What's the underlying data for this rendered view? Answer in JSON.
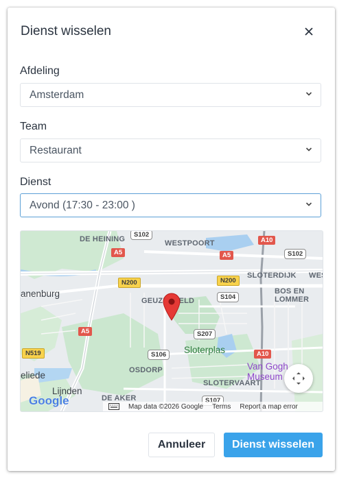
{
  "dialog": {
    "title": "Dienst wisselen"
  },
  "fields": {
    "afdeling": {
      "label": "Afdeling",
      "value": "Amsterdam"
    },
    "team": {
      "label": "Team",
      "value": "Restaurant"
    },
    "dienst": {
      "label": "Dienst",
      "value": "Avond (17:30 - 23:00 )"
    }
  },
  "map": {
    "areas": [
      "DE HEINING",
      "WESTPOORT",
      "SLOTERDIJK",
      "BOS EN",
      "LOMMER",
      "WES",
      "GEUZENVELD",
      "OSDORP",
      "SLOTERVAART",
      "DE AKER"
    ],
    "places": [
      "anenburg",
      "Sloterplas",
      "Van Gogh Museum",
      "eliede",
      "Lijnden"
    ],
    "roads": {
      "s102a": "S102",
      "s102b": "S102",
      "a10a": "A10",
      "a10b": "A10",
      "a5a": "A5",
      "a5b": "A5",
      "a5c": "A5",
      "n200a": "N200",
      "n200b": "N200",
      "s104": "S104",
      "s207": "S207",
      "s106": "S106",
      "n519": "N519",
      "s107": "S107"
    },
    "attribution": {
      "data": "Map data ©2026 Google",
      "terms": "Terms",
      "report": "Report a map error"
    },
    "logo": "Google"
  },
  "actions": {
    "cancel": "Annuleer",
    "confirm": "Dienst wisselen"
  },
  "colors": {
    "primary": "#3aa3ea",
    "text": "#2b3440",
    "border": "#dfe3e8",
    "active_border": "#5b9fd6",
    "marker": "#e53935"
  }
}
